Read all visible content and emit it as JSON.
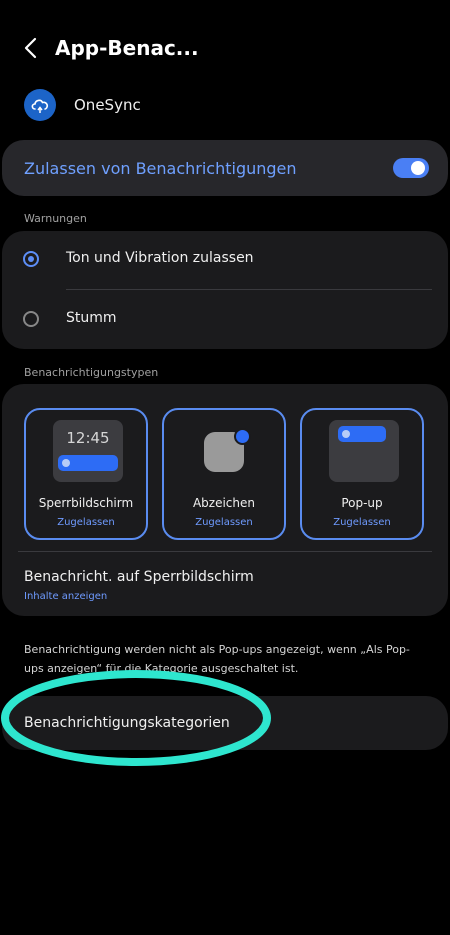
{
  "header": {
    "title": "App-Benac..."
  },
  "app": {
    "name": "OneSync",
    "icon": "cloud-sync-icon"
  },
  "allow_notifications": {
    "label": "Zulassen von Benachrichtigungen",
    "enabled": true
  },
  "alerts": {
    "section_label": "Warnungen",
    "options": [
      {
        "label": "Ton und Vibration zulassen",
        "selected": true
      },
      {
        "label": "Stumm",
        "selected": false
      }
    ]
  },
  "notification_types": {
    "section_label": "Benachrichtigungstypen",
    "tiles": [
      {
        "label": "Sperrbildschirm",
        "status": "Zugelassen",
        "preview_time": "12:45"
      },
      {
        "label": "Abzeichen",
        "status": "Zugelassen"
      },
      {
        "label": "Pop-up",
        "status": "Zugelassen"
      }
    ],
    "lockscreen": {
      "title": "Benachricht. auf Sperrbildschirm",
      "subtitle": "Inhalte anzeigen"
    }
  },
  "info_text": "Benachrichtigung werden nicht als Pop-ups angezeigt, wenn „Als Pop-ups anzeigen“ für die Kategorie ausgeschaltet ist.",
  "categories": {
    "label": "Benachrichtigungskategorien"
  },
  "colors": {
    "accent": "#5d8ef6",
    "highlight": "#2ee6cf",
    "card": "#1b1b1d"
  }
}
